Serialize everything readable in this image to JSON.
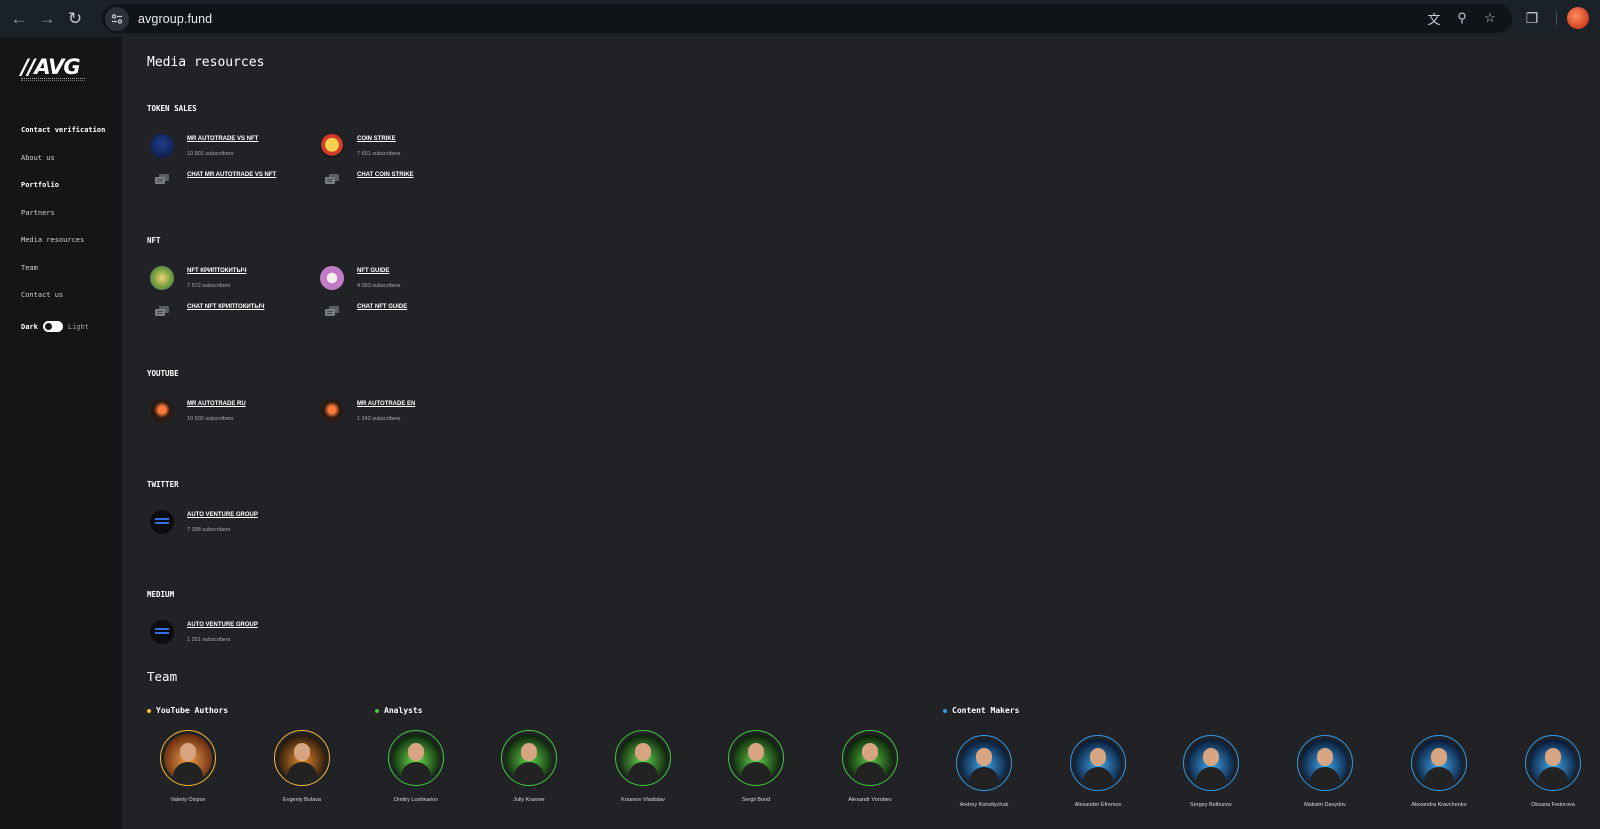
{
  "browser": {
    "url": "avgroup.fund"
  },
  "sidebar": {
    "logo": "//AVG",
    "items": [
      {
        "label": "Contact verification",
        "bold": true
      },
      {
        "label": "About us",
        "bold": false
      },
      {
        "label": "Portfolio",
        "bold": true
      },
      {
        "label": "Partners",
        "bold": false
      },
      {
        "label": "Media resources",
        "bold": false
      },
      {
        "label": "Team",
        "bold": false
      },
      {
        "label": "Contact us",
        "bold": false
      }
    ],
    "theme": {
      "dark": "Dark",
      "light": "Light"
    }
  },
  "main": {
    "title": "Media resources",
    "sections": [
      {
        "title": "TOKEN SALES",
        "resources": [
          {
            "name": "MR AUTOTRADE VS NFT",
            "subscribers": "10 801 subscribers",
            "chat": "CHAT MR AUTOTRADE VS NFT"
          },
          {
            "name": "COIN STRIKE",
            "subscribers": "7 651 subscribers",
            "chat": "CHAT COIN STRIKE"
          }
        ]
      },
      {
        "title": "NFT",
        "resources": [
          {
            "name": "NFT КРИПТОКИТЫЧ",
            "subscribers": "7 572 subscribers",
            "chat": "CHAT NFT КРИПТОКИТЫЧ"
          },
          {
            "name": "NFT GUIDE",
            "subscribers": "4 093 subscribers",
            "chat": "CHAT NFT GUIDE"
          }
        ]
      },
      {
        "title": "YOUTUBE",
        "resources": [
          {
            "name": "MR AUTOTRADE RU",
            "subscribers": "10 500 subscribers"
          },
          {
            "name": "MR AUTOTRADE EN",
            "subscribers": "1 242 subscribers"
          }
        ]
      },
      {
        "title": "TWITTER",
        "resources": [
          {
            "name": "AUTO VENTURE GROUP",
            "subscribers": "7 398 subscribers"
          }
        ]
      },
      {
        "title": "MEDIUM",
        "resources": [
          {
            "name": "AUTO VENTURE GROUP",
            "subscribers": "1 251 subscribers"
          }
        ]
      }
    ]
  },
  "team": {
    "title": "Team",
    "groups": [
      {
        "label": "YouTube Authors",
        "color": "#f5b82e"
      },
      {
        "label": "Analysts",
        "color": "#3ecb3a"
      },
      {
        "label": "Content Makers",
        "color": "#2f9be8"
      }
    ],
    "members": [
      {
        "name": "Valeriy Osipov",
        "group": 0
      },
      {
        "name": "Evgeniy Bulava",
        "group": 0
      },
      {
        "name": "Dmitry Loshkariov",
        "group": 1
      },
      {
        "name": "Juliy Krasner",
        "group": 1
      },
      {
        "name": "Krasnov Vladislav",
        "group": 1
      },
      {
        "name": "Sergii Bond",
        "group": 1
      },
      {
        "name": "Alexandr Vorobev",
        "group": 1
      },
      {
        "name": "Andrey Kolodiychuk",
        "group": 2
      },
      {
        "name": "Alexander Efremov",
        "group": 2
      },
      {
        "name": "Sergey Bolbunov",
        "group": 2
      },
      {
        "name": "Maksim Davydov",
        "group": 2
      },
      {
        "name": "Alexandra Kravchenko",
        "group": 2
      },
      {
        "name": "Oksana Fedorova",
        "group": 2
      }
    ]
  }
}
